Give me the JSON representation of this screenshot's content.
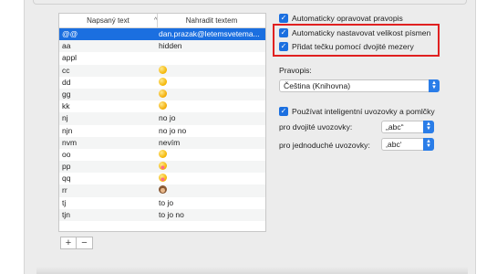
{
  "table": {
    "headers": {
      "typed": "Napsaný text",
      "replace": "Nahradit textem"
    },
    "rows": [
      {
        "typed": "@@",
        "replace": "dan.prazak@letemsvetema...",
        "kind": "text",
        "selected": true
      },
      {
        "typed": "aa",
        "replace": "hidden",
        "kind": "text"
      },
      {
        "typed": "appl",
        "replace": "",
        "kind": "apple",
        "glyph": ""
      },
      {
        "typed": "cc",
        "replace": "",
        "kind": "emoji",
        "icon": "smile-emoji"
      },
      {
        "typed": "dd",
        "replace": "",
        "kind": "emoji",
        "icon": "grin-emoji"
      },
      {
        "typed": "gg",
        "replace": "",
        "kind": "emoji",
        "icon": "smirk-emoji"
      },
      {
        "typed": "kk",
        "replace": "",
        "kind": "emoji",
        "icon": "laugh-emoji"
      },
      {
        "typed": "nj",
        "replace": "no jo",
        "kind": "text"
      },
      {
        "typed": "njn",
        "replace": "no jo no",
        "kind": "text"
      },
      {
        "typed": "nvm",
        "replace": "nevím",
        "kind": "text"
      },
      {
        "typed": "oo",
        "replace": "",
        "kind": "emoji",
        "icon": "blush-emoji"
      },
      {
        "typed": "pp",
        "replace": "",
        "kind": "emoji",
        "icon": "tongue-emoji"
      },
      {
        "typed": "qq",
        "replace": "",
        "kind": "emoji",
        "icon": "kiss-emoji"
      },
      {
        "typed": "rr",
        "replace": "",
        "kind": "emoji",
        "icon": "monkey-emoji"
      },
      {
        "typed": "tj",
        "replace": "to jo",
        "kind": "text"
      },
      {
        "typed": "tjn",
        "replace": "to jo no",
        "kind": "text"
      }
    ],
    "add_label": "+",
    "remove_label": "−"
  },
  "options": {
    "autocorrect": "Automaticky opravovat pravopis",
    "autocapitalize": "Automaticky nastavovat velikost písmen",
    "period_double_space": "Přidat tečku pomocí dvojité mezery",
    "check_mark": "✓"
  },
  "spelling": {
    "label": "Pravopis:",
    "value": "Čeština (Knihovna)"
  },
  "quotes": {
    "smart_label": "Používat inteligentní uvozovky a pomlčky",
    "double_label": "pro dvojité uvozovky:",
    "double_value": "„abc“",
    "single_label": "pro jednoduché uvozovky:",
    "single_value": "‚abc‘"
  },
  "colors": {
    "accent": "#1b6fe0",
    "highlight": "#e02020"
  }
}
